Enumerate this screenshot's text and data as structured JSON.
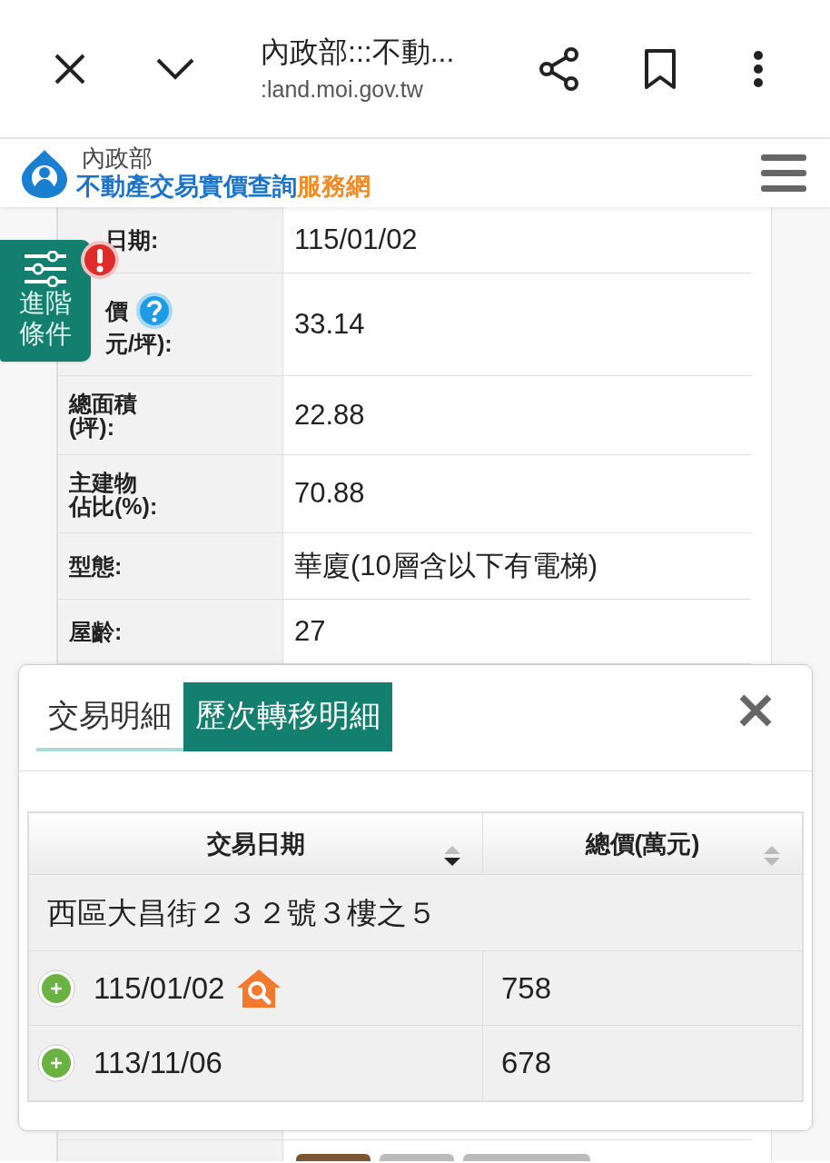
{
  "browser_bar": {
    "title": "內政部:::不動...",
    "url": ":land.moi.gov.tw"
  },
  "site_header": {
    "ministry": "內政部",
    "title_main": "不動產交易實價查詢",
    "title_accent": "服務網"
  },
  "filter_button": {
    "label_line_1": "進階",
    "label_line_2": "條件",
    "alert": true
  },
  "detail_rows": [
    {
      "kind": "plain",
      "label_lines": [
        "日期:"
      ],
      "value": "115/01/02"
    },
    {
      "kind": "help",
      "label_lines": [
        "價",
        "元/坪):"
      ],
      "value": "33.14"
    },
    {
      "kind": "plain",
      "label_lines": [
        "總面積",
        "(坪):"
      ],
      "value": "22.88"
    },
    {
      "kind": "plain",
      "label_lines": [
        "主建物",
        "佔比(%):"
      ],
      "value": "70.88"
    },
    {
      "kind": "plain",
      "label_lines": [
        "型態:"
      ],
      "value": "華廈(10層含以下有電梯)"
    },
    {
      "kind": "plain",
      "label_lines": [
        "屋齡:"
      ],
      "value": "27"
    }
  ],
  "modal": {
    "tabs": [
      {
        "label": "交易明細",
        "selected": false
      },
      {
        "label": "歷次轉移明細",
        "selected": true
      }
    ],
    "table": {
      "columns": [
        {
          "label": "交易日期",
          "sorted_descending": true
        },
        {
          "label": "總價(萬元)",
          "sorted_descending": false
        }
      ],
      "group": "西區大昌街２３２號３樓之５",
      "rows": [
        {
          "date": "115/01/02",
          "price": "758",
          "lookup": true
        },
        {
          "date": "113/11/06",
          "price": "678",
          "lookup": false
        }
      ]
    }
  }
}
